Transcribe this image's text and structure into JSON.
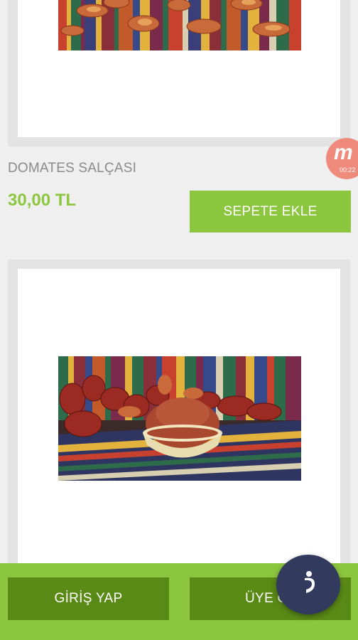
{
  "product": {
    "name": "DOMATES SALÇASI",
    "price": "30,00 TL",
    "add_to_cart_label": "SEPETE EKLE"
  },
  "badge": {
    "letter": "m",
    "time": "00:22",
    "color": "#f07a6a"
  },
  "bottom_bar": {
    "login_label": "GİRİŞ YAP",
    "signup_label": "ÜYE OL"
  },
  "colors": {
    "accent": "#8cc63f",
    "dark_accent": "#5a8a16",
    "fab": "#323a5e"
  },
  "icons": {
    "fab_icon": "chat-assistant-icon"
  }
}
